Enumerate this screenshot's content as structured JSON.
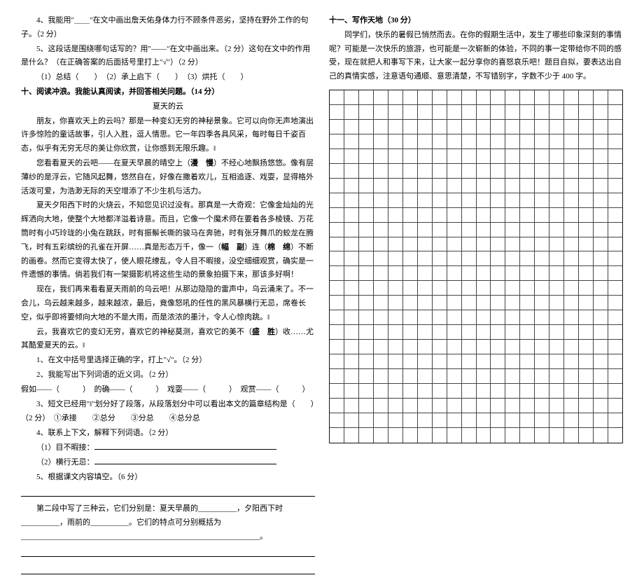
{
  "left": {
    "q4": "4、我能用\"＿＿\"在文中画出詹天佑身体力行不顾条件恶劣，坚持在野外工作的句子。（2 分）",
    "q5a": "5、这段话是围绕哪句话写的？用\"——\"在文中画出来。（2 分）这句在文中的作用是什么？（在正确答案的后面括号里打上\"√\"）（2 分）",
    "q5b": "（1）总结（　　）　（2）承上启下（　　）　（3）烘托（　　）",
    "s10_title": "十、阅读冲浪。我能认真阅读，并回答相关问题。（14 分）",
    "article_title": "夏天的云",
    "p1": "朋友，你喜欢天上的云吗？那是一种变幻无穷的神秘景象。它可以向你无声地演出许多惊险的童话故事，引人入胜，逗人情思。它一年四季各具风采，每时每日千姿百态，似乎有无穷无尽的美让你欣赏，让你感到无限乐趣。‖",
    "p2a": "您看看夏天的云吧——在夏天早晨的晴空上（",
    "p2_bold1": "漫　慢",
    "p2b": "）不经心地飘扬悠悠。像有层薄纱的是浮云，它随风起舞，悠然自在，好像在撒着欢儿，互相追逐、戏耍，显得格外活泼可爱，为浩渺无际的天空增添了不少生机与活力。",
    "p3a": "夏天夕阳西下时的火烧云，不知您见识过没有。那真是一大奇观：它像金灿灿的光辉洒向大地，使整个大地都洋溢着诗意。而且，它像一个魔术师在要着各多棱镜、万花筒时有小巧玲珑的小兔在跳跃，时有振鬃长嘶的骏马在奔驰，时有张牙舞爪的蛟龙在腾飞，时有五彩缤纷的孔雀在开屏……真是形态万千，像一（",
    "p3_bold1": "幅　副",
    "p3b": "）连（",
    "p3_bold2": "棉　绵",
    "p3c": "）不断的画卷。然而它变得太快了，使人眼花缭乱，令人目不暇接，没空细细观赏，确实是一件遗憾的事情。倘若我们有一架摄影机将这些生动的景象拍摄下来，那该多好啊！",
    "p4": "现在，我们再来看看夏天雨前的乌云吧！从那边隐隐的雷声中，乌云涌来了。不一会儿，乌云越来越多，越来越浓，最后，竟像怒吼的任性的黑风暴横行无忌，席卷长空，似乎即将要倾向大地的不是大雨，而是浓浓的墨汁，令人心惊肉跳。‖",
    "p5a": "云，我喜欢它的变幻无穷，喜欢它的神秘莫测，喜欢它的美不（",
    "p5_bold1": "盛　胜",
    "p5b": "）收……尤其酷爱夏天的云。‖",
    "sq1": "1、在文中括号里选择正确的字，打上\"√\"。（2 分）",
    "sq2": "2、我能写出下列词语的近义词。（2 分）",
    "sq2_line": "假如——（　　　）　的确——（　　　）　戏耍——（　　　）　观赏——（　　　）",
    "sq3a": "3、短文已经用\"‖\"划分好了段落，从段落划分中可以看出本文的篇章结构是（　　）",
    "sq3b": "（2 分）　①承接　　②总分　　③分总　　④总分总",
    "sq4": "4、联系上下文，解释下列词语。（2 分）",
    "sq4a": "（1）目不暇接：",
    "sq4b": "（2）横行无忌：",
    "sq5": "5、根据课文内容填空。（6 分）",
    "sq5_text1": "第二段中写了三种云，它们分别是：夏天早晨的__________，夕阳西下时__________，雨前的__________。它们的特点可分别概括为______________________________________________________________。"
  },
  "right": {
    "s11_title": "十一、写作天地（30 分）",
    "prompt": "同学们，快乐的暑假已悄然而去。在你的假期生活中，发生了哪些印象深刻的事情呢？可能是一次快乐的旅游，也可能是一次崭新的体验，不同的事一定带给你不同的感受，现在就把人和事写下来，让大家一起分享你的喜怒哀乐吧！题目自拟，要表达出自己的真情实感，注意语句通顺、意思清楚，不写错别字，字数不少于 400 字。",
    "grid": {
      "rows": 24,
      "cols": 20
    }
  }
}
